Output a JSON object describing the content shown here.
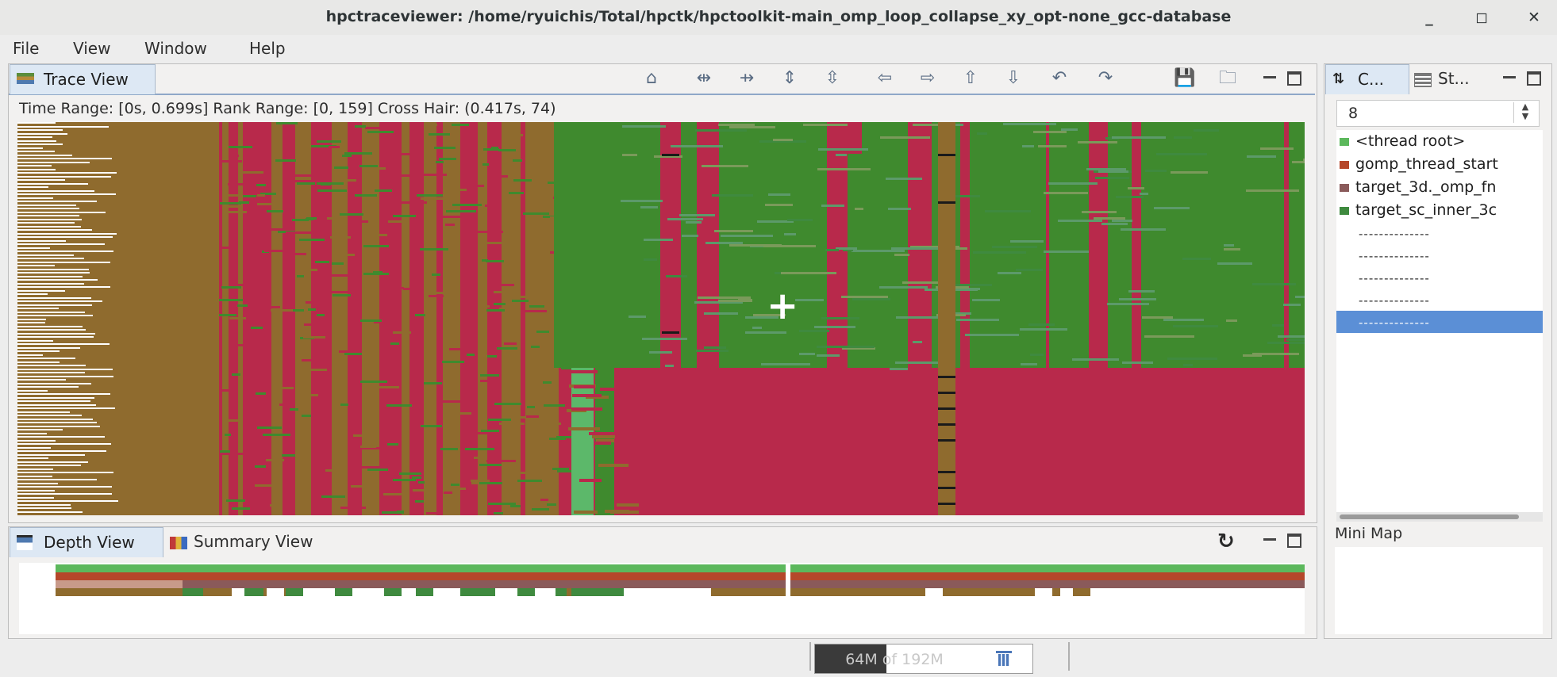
{
  "window": {
    "title": "hpctraceviewer: /home/ryuichis/Total/hpctk/hpctoolkit-main_omp_loop_collapse_xy_opt-none_gcc-database",
    "minimize_glyph": "_",
    "maximize_glyph": "◻",
    "close_glyph": "✕"
  },
  "menu": [
    "File",
    "View",
    "Window",
    "Help"
  ],
  "trace_view": {
    "tab_label": "Trace View",
    "info_text": "Time Range: [0s, 0.699s]  Rank Range: [0, 159]  Cross Hair: (0.417s, 74)",
    "crosshair_glyph": "+",
    "toolbar_icons": [
      "home-icon",
      "zoom-in-time-icon",
      "zoom-out-time-icon",
      "zoom-in-rank-icon",
      "zoom-out-rank-icon",
      "pan-left-icon",
      "pan-right-icon",
      "pan-up-icon",
      "pan-down-icon",
      "undo-icon",
      "redo-icon",
      "save-icon",
      "open-icon"
    ],
    "toolbar_glyphs": [
      "⌂",
      "⇹",
      "⇸",
      "⇕",
      "⇳",
      "⇦",
      "⇨",
      "⇧",
      "⇩",
      "↶",
      "↷",
      "💾",
      "🗀"
    ]
  },
  "depth_view": {
    "tab_label": "Depth View",
    "summary_tab_label": "Summary View",
    "refresh_glyph": "↻"
  },
  "side_panel": {
    "tab1_label": "C...",
    "tab2_label": "St...",
    "depth_value": "8",
    "legend": [
      {
        "label": "<thread root>",
        "color": "#5cb85c"
      },
      {
        "label": "gomp_thread_start",
        "color": "#b5472a"
      },
      {
        "label": "target_3d._omp_fn",
        "color": "#8a5a5a"
      },
      {
        "label": "target_sc_inner_3c",
        "color": "#3f8a3f"
      }
    ],
    "placeholders": [
      "--------------",
      "--------------",
      "--------------",
      "--------------",
      "--------------"
    ],
    "minimap_label": "Mini Map"
  },
  "status": {
    "memory_text": "64M of 192M",
    "gc_icon": "trash-icon"
  },
  "colors": {
    "brown": "#8f6b2e",
    "crimson": "#b8294b",
    "green": "#3f8a2e",
    "lightgreen": "#5cb86a",
    "selection": "#5b8fd6"
  }
}
